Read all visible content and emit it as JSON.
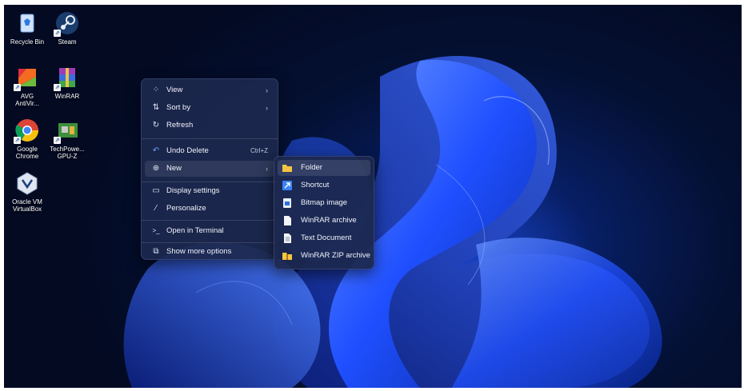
{
  "desktop": {
    "icons": [
      {
        "label": "Recycle Bin",
        "icon": "recycle-bin-icon"
      },
      {
        "label": "Steam",
        "icon": "steam-icon"
      },
      {
        "label": "AVG AntiVir...",
        "icon": "avg-antivirus-icon"
      },
      {
        "label": "WinRAR",
        "icon": "winrar-icon"
      },
      {
        "label": "Google Chrome",
        "icon": "chrome-icon"
      },
      {
        "label": "TechPowe... GPU-Z",
        "icon": "gpu-z-icon"
      },
      {
        "label": "Oracle VM VirtualBox",
        "icon": "virtualbox-icon"
      }
    ]
  },
  "context_menu": {
    "items": [
      {
        "label": "View",
        "icon": "grid-icon",
        "has_submenu": true
      },
      {
        "label": "Sort by",
        "icon": "sort-icon",
        "has_submenu": true
      },
      {
        "label": "Refresh",
        "icon": "refresh-icon"
      },
      {
        "label": "Undo Delete",
        "icon": "undo-icon",
        "accelerator": "Ctrl+Z"
      },
      {
        "label": "New",
        "icon": "plus-circle-icon",
        "has_submenu": true,
        "highlighted": true
      },
      {
        "label": "Display settings",
        "icon": "display-icon"
      },
      {
        "label": "Personalize",
        "icon": "brush-icon"
      },
      {
        "label": "Open in Terminal",
        "icon": "terminal-icon"
      },
      {
        "label": "Show more options",
        "icon": "more-options-icon"
      }
    ]
  },
  "new_submenu": {
    "items": [
      {
        "label": "Folder",
        "icon": "folder-icon",
        "highlighted": true
      },
      {
        "label": "Shortcut",
        "icon": "shortcut-icon"
      },
      {
        "label": "Bitmap image",
        "icon": "bitmap-icon"
      },
      {
        "label": "WinRAR archive",
        "icon": "document-icon"
      },
      {
        "label": "Text Document",
        "icon": "text-document-icon"
      },
      {
        "label": "WinRAR ZIP archive",
        "icon": "zip-folder-icon"
      }
    ]
  },
  "colors": {
    "wallpaper_dark": "#041033",
    "bloom_blue": "#1f4fff",
    "menu_bg": "#1c284e",
    "folder_yellow": "#f4c542"
  }
}
